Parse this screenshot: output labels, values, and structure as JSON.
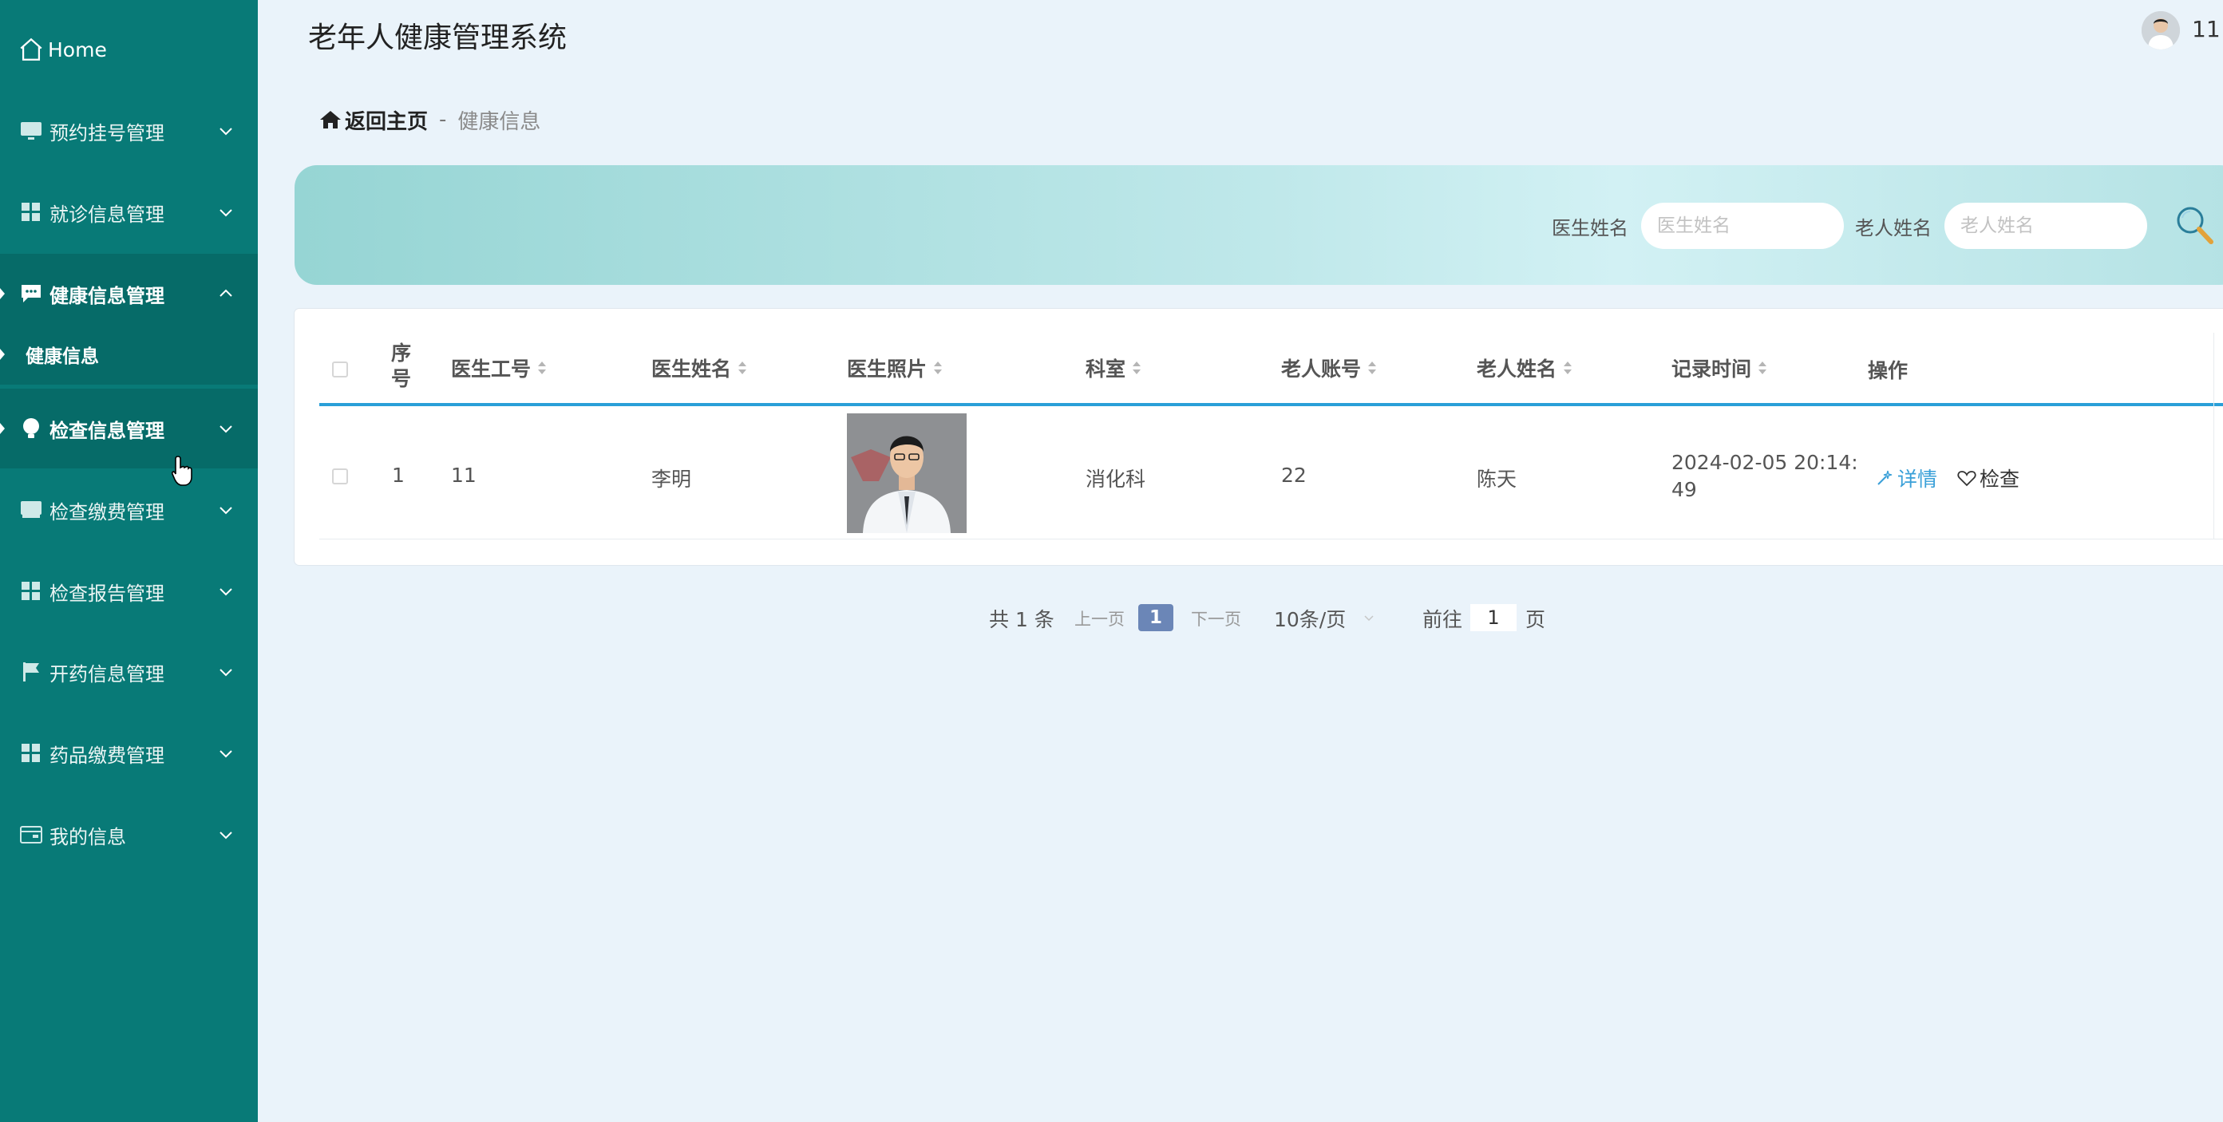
{
  "app": {
    "title": "老年人健康管理系统",
    "user_name": "11"
  },
  "sidebar": {
    "home_label": "Home",
    "items": [
      {
        "label": "预约挂号管理",
        "icon": "monitor-icon"
      },
      {
        "label": "就诊信息管理",
        "icon": "grid-icon"
      },
      {
        "label": "健康信息管理",
        "icon": "chat-icon",
        "expanded": true,
        "active": true
      },
      {
        "label": "检查信息管理",
        "icon": "bulb-icon"
      },
      {
        "label": "检查缴费管理",
        "icon": "monitor-icon"
      },
      {
        "label": "检查报告管理",
        "icon": "grid-icon"
      },
      {
        "label": "开药信息管理",
        "icon": "flag-icon"
      },
      {
        "label": "药品缴费管理",
        "icon": "grid-icon"
      },
      {
        "label": "我的信息",
        "icon": "card-icon"
      }
    ],
    "sub_item": "健康信息"
  },
  "breadcrumb": {
    "home": "返回主页",
    "separator": "-",
    "current": "健康信息"
  },
  "search": {
    "doctor_label": "医生姓名",
    "doctor_placeholder": "医生姓名",
    "elder_label": "老人姓名",
    "elder_placeholder": "老人姓名"
  },
  "table": {
    "headers": {
      "index": "序号",
      "doctor_id": "医生工号",
      "doctor_name": "医生姓名",
      "doctor_photo": "医生照片",
      "department": "科室",
      "elder_account": "老人账号",
      "elder_name": "老人姓名",
      "record_time": "记录时间",
      "actions": "操作"
    },
    "rows": [
      {
        "index": "1",
        "doctor_id": "11",
        "doctor_name": "李明",
        "department": "消化科",
        "elder_account": "22",
        "elder_name": "陈天",
        "record_time_line1": "2024-02-05 20:14:",
        "record_time_line2": "49",
        "detail_label": "详情",
        "check_label": "检查"
      }
    ]
  },
  "pagination": {
    "total": "共 1 条",
    "prev": "上一页",
    "current_page": "1",
    "next": "下一页",
    "page_size": "10条/页",
    "goto_prefix": "前往",
    "goto_value": "1",
    "goto_suffix": "页"
  },
  "colors": {
    "sidebar_bg": "#087a77",
    "accent_blue": "#2a9fd8",
    "page_btn": "#6b86b7"
  }
}
